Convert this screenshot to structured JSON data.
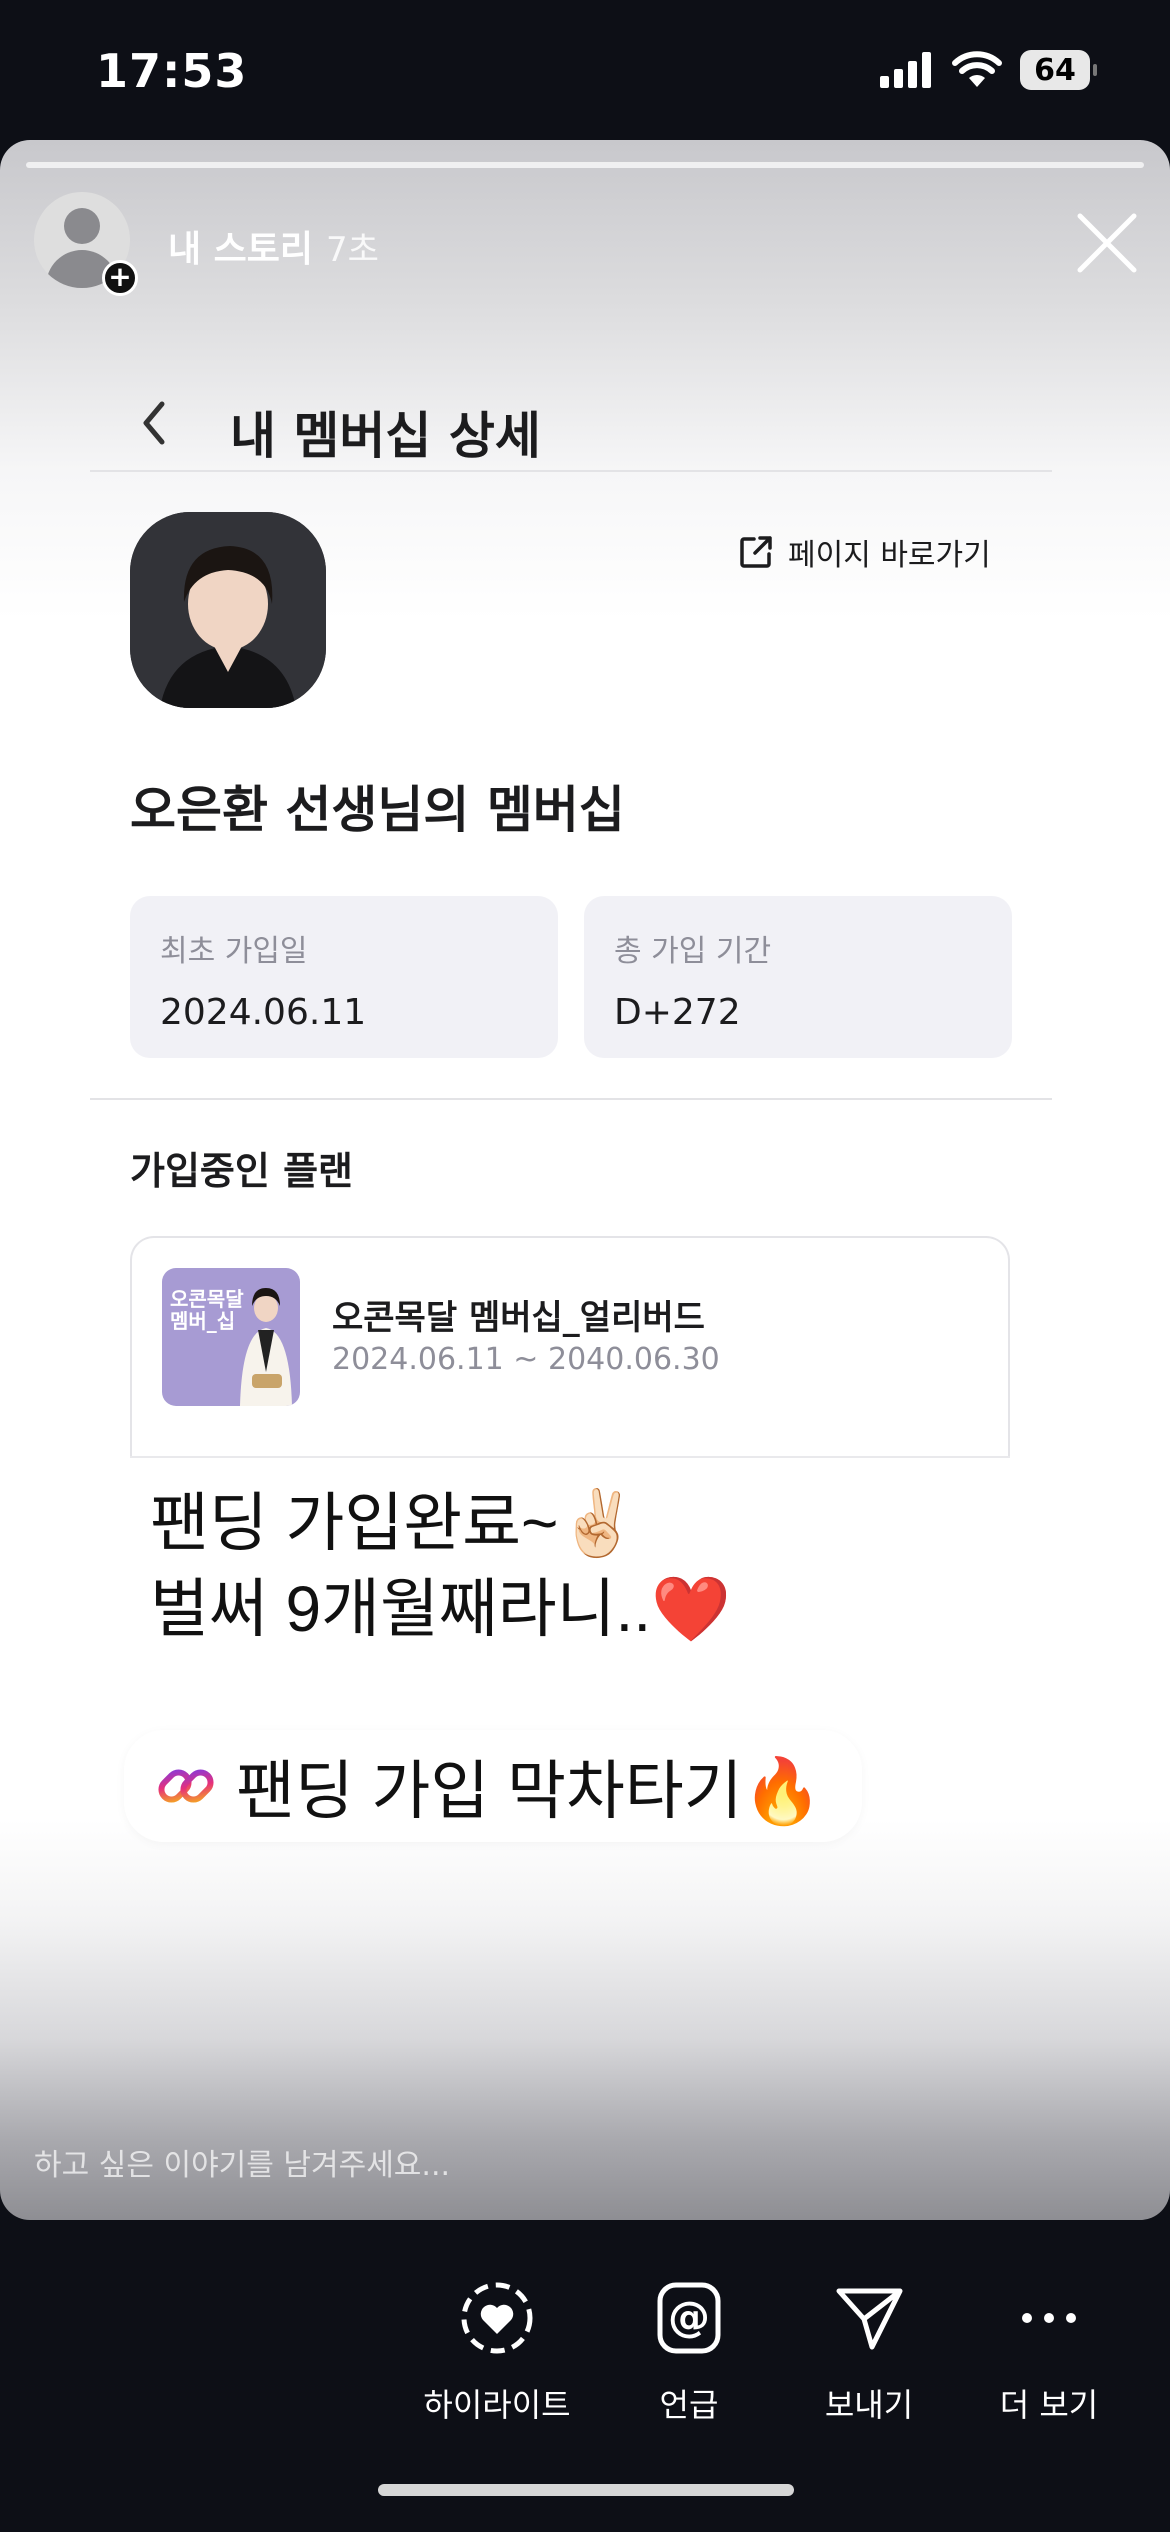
{
  "status_bar": {
    "time": "17:53",
    "battery": "64"
  },
  "story": {
    "user": "내 스토리",
    "time_ago": "7초",
    "reply_placeholder": "하고 싶은 이야기를 남겨주세요...",
    "caption_line1": "팬딩 가입완료~✌🏻",
    "caption_line2": "벌써 9개월째라니..❤️",
    "link_sticker_text": "팬딩 가입 막차타기🔥"
  },
  "inner_page": {
    "title": "내 멤버십 상세",
    "shortcut_label": "페이지 바로가기",
    "membership_title": "오은환 선생님의 멤버십",
    "first_join_label": "최초 가입일",
    "first_join_value": "2024.06.11",
    "total_period_label": "총 가입 기간",
    "total_period_value": "D+272",
    "plans_title": "가입중인 플랜",
    "plan": {
      "thumb_title": "오콘목달 멤버_십",
      "name": "오콘목달 멤버십_얼리버드",
      "period": "2024.06.11 ~ 2040.06.30"
    }
  },
  "actions": [
    {
      "label": "하이라이트",
      "icon": "highlight-heart-icon"
    },
    {
      "label": "언급",
      "icon": "at-mention-icon"
    },
    {
      "label": "보내기",
      "icon": "send-paper-plane-icon"
    },
    {
      "label": "더 보기",
      "icon": "more-dots-icon"
    }
  ]
}
